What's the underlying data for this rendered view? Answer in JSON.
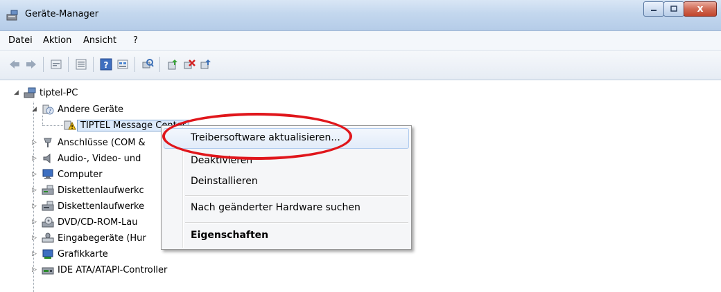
{
  "window": {
    "title": "Geräte-Manager",
    "app_icon": "device-manager-icon",
    "controls": {
      "close_glyph": "x"
    }
  },
  "menu": {
    "items": [
      "Datei",
      "Aktion",
      "Ansicht",
      "?"
    ]
  },
  "toolbar": {
    "buttons": [
      "back-arrow-icon",
      "forward-arrow-icon",
      "properties-icon",
      "list-view-icon",
      "help-icon",
      "resource-view-icon",
      "scan-hardware-icon",
      "update-driver-icon",
      "uninstall-icon",
      "enable-device-icon"
    ]
  },
  "tree": {
    "root": "tiptel-PC",
    "nodes": [
      {
        "label": "Andere Geräte",
        "icon": "unknown-device-category-icon",
        "expanded": true
      },
      {
        "label": "TIPTEL Message Center",
        "icon": "warning-device-icon",
        "selected": true
      },
      {
        "label": "Anschlüsse (COM &",
        "icon": "ports-icon"
      },
      {
        "label": "Audio-, Video- und",
        "icon": "audio-icon"
      },
      {
        "label": "Computer",
        "icon": "computer-icon"
      },
      {
        "label": "Diskettenlaufwerkc",
        "icon": "floppy-controller-icon"
      },
      {
        "label": "Diskettenlaufwerke",
        "icon": "floppy-drive-icon"
      },
      {
        "label": "DVD/CD-ROM-Lau",
        "icon": "dvd-icon"
      },
      {
        "label": "Eingabegeräte (Hur",
        "icon": "input-device-icon"
      },
      {
        "label": "Grafikkarte",
        "icon": "display-adapter-icon"
      },
      {
        "label": "IDE ATA/ATAPI-Controller",
        "icon": "ide-controller-icon"
      }
    ]
  },
  "context_menu": {
    "items": [
      {
        "label": "Treibersoftware aktualisieren...",
        "hover": true
      },
      {
        "label": "Deaktivieren"
      },
      {
        "label": "Deinstallieren"
      },
      {
        "label": "Nach geänderter Hardware suchen"
      },
      {
        "label": "Eigenschaften",
        "bold": true
      }
    ]
  },
  "colors": {
    "highlight_ellipse": "#e0161b",
    "selection": "#dbe9fb",
    "titlebar": "#c3d7ee"
  }
}
